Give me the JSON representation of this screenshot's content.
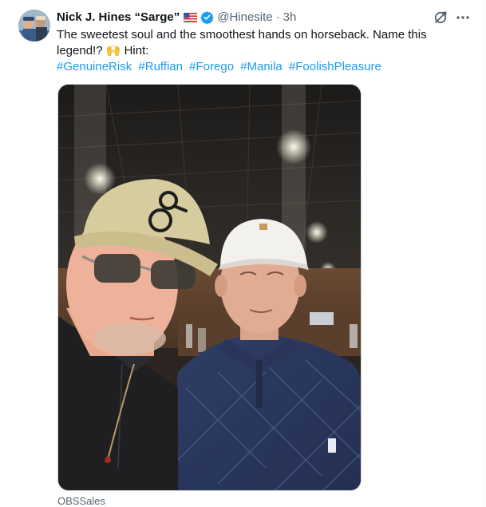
{
  "author": {
    "name": "Nick J. Hines “Sarge”",
    "flag_emoji": "us-flag",
    "verified_color": "#1d9bf0",
    "handle": "@Hinesite",
    "separator": "·",
    "time": "3h"
  },
  "tweet": {
    "text": "The sweetest soul and the smoothest hands on horseback. Name this legend!? 🙌 Hint:",
    "hashtags": [
      "#GenuineRisk",
      "#Ruffian",
      "#Forego",
      "#Manila",
      "#FoolishPleasure"
    ],
    "link_color": "#1d9bf0"
  },
  "media": {
    "description_icon": "photo-of-two-men"
  },
  "attribution": {
    "label": "OBSSales"
  },
  "icons": {
    "grok": "grok-icon",
    "more": "more-icon"
  }
}
